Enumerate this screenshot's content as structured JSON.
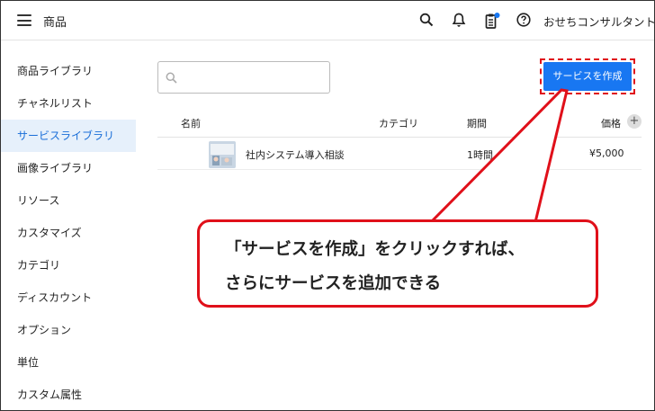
{
  "header": {
    "title": "商品",
    "user_name": "おせちコンサルタント",
    "icons": [
      "menu-icon",
      "search-icon",
      "bell-icon",
      "clipboard-icon",
      "help-icon"
    ],
    "notification_dot_color": "#1877f2"
  },
  "sidebar": {
    "items": [
      {
        "label": "商品ライブラリ",
        "active": false
      },
      {
        "label": "チャネルリスト",
        "active": false
      },
      {
        "label": "サービスライブラリ",
        "active": true
      },
      {
        "label": "画像ライブラリ",
        "active": false
      },
      {
        "label": "リソース",
        "active": false
      },
      {
        "label": "カスタマイズ",
        "active": false
      },
      {
        "label": "カテゴリ",
        "active": false
      },
      {
        "label": "ディスカウント",
        "active": false
      },
      {
        "label": "オプション",
        "active": false
      },
      {
        "label": "単位",
        "active": false
      },
      {
        "label": "カスタム属性",
        "active": false
      }
    ]
  },
  "search": {
    "placeholder": "",
    "value": ""
  },
  "create_button": {
    "label": "サービスを作成",
    "color": "#1877f2"
  },
  "table": {
    "columns": [
      "名前",
      "カテゴリ",
      "期間",
      "価格"
    ],
    "add_column_symbol": "+",
    "rows": [
      {
        "name": "社内システム導入相談",
        "category": "",
        "duration": "1時間",
        "price": "¥5,000"
      }
    ]
  },
  "callout": {
    "line1": "「サービスを作成」をクリックすれば、",
    "line2": "さらにサービスを追加できる",
    "border_color": "#e0101a"
  }
}
